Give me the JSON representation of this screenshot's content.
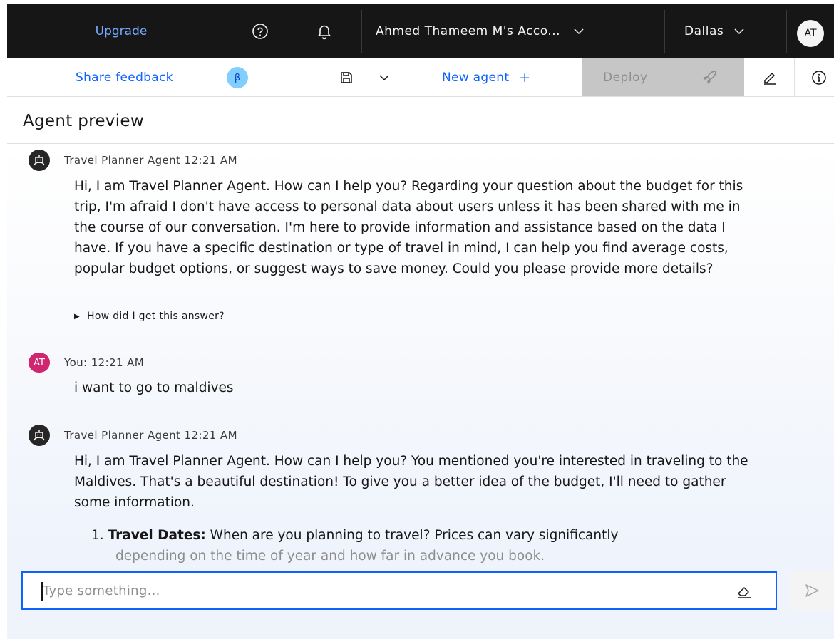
{
  "topbar": {
    "upgrade_label": "Upgrade",
    "account_label": "Ahmed Thameem M's Acco...",
    "region_label": "Dallas",
    "avatar_initials": "AT"
  },
  "toolbar": {
    "share_feedback_label": "Share feedback",
    "beta_badge": "β",
    "new_agent_label": "New agent",
    "new_agent_plus": "+",
    "deploy_label": "Deploy"
  },
  "page": {
    "title": "Agent preview"
  },
  "messages": [
    {
      "sender": "Travel Planner Agent",
      "time": "12:21 AM",
      "text": "Hi, I am Travel Planner Agent. How can I help you? Regarding your question about the budget for this trip, I'm afraid I don't have access to personal data about users unless it has been shared with me in the course of our conversation. I'm here to provide information and assistance based on the data I have. If you have a specific destination or type of travel in mind, I can help you find average costs, popular budget options, or suggest ways to save money. Could you please provide more details?",
      "expander": "How did I get this answer?"
    },
    {
      "sender": "You:",
      "time": "12:21 AM",
      "avatar": "AT",
      "text": "i want to go to maldives"
    },
    {
      "sender": "Travel Planner Agent",
      "time": "12:21 AM",
      "text": "Hi, I am Travel Planner Agent. How can I help you? You mentioned you're interested in traveling to the Maldives. That's a beautiful destination! To give you a better idea of the budget, I'll need to gather some information.",
      "list": [
        {
          "number": "1.",
          "term": "Travel Dates:",
          "line1": "When are you planning to travel? Prices can vary significantly",
          "line2": "depending on the time of year and how far in advance you book."
        }
      ]
    }
  ],
  "input": {
    "placeholder": "Type something..."
  },
  "icons": {
    "help": "help-icon",
    "bell": "notification-icon",
    "chevron": "chevron-down-icon",
    "save": "save-icon",
    "rocket": "rocket-icon",
    "edit": "edit-icon",
    "info": "info-icon",
    "bot": "bot-icon",
    "eraser": "eraser-icon",
    "send": "send-icon"
  },
  "colors": {
    "accent": "#0f62fe",
    "topbar_bg": "#161616",
    "upgrade_link": "#78a9ff",
    "user_avatar": "#d02670",
    "beta_badge_bg": "#82cfff"
  }
}
